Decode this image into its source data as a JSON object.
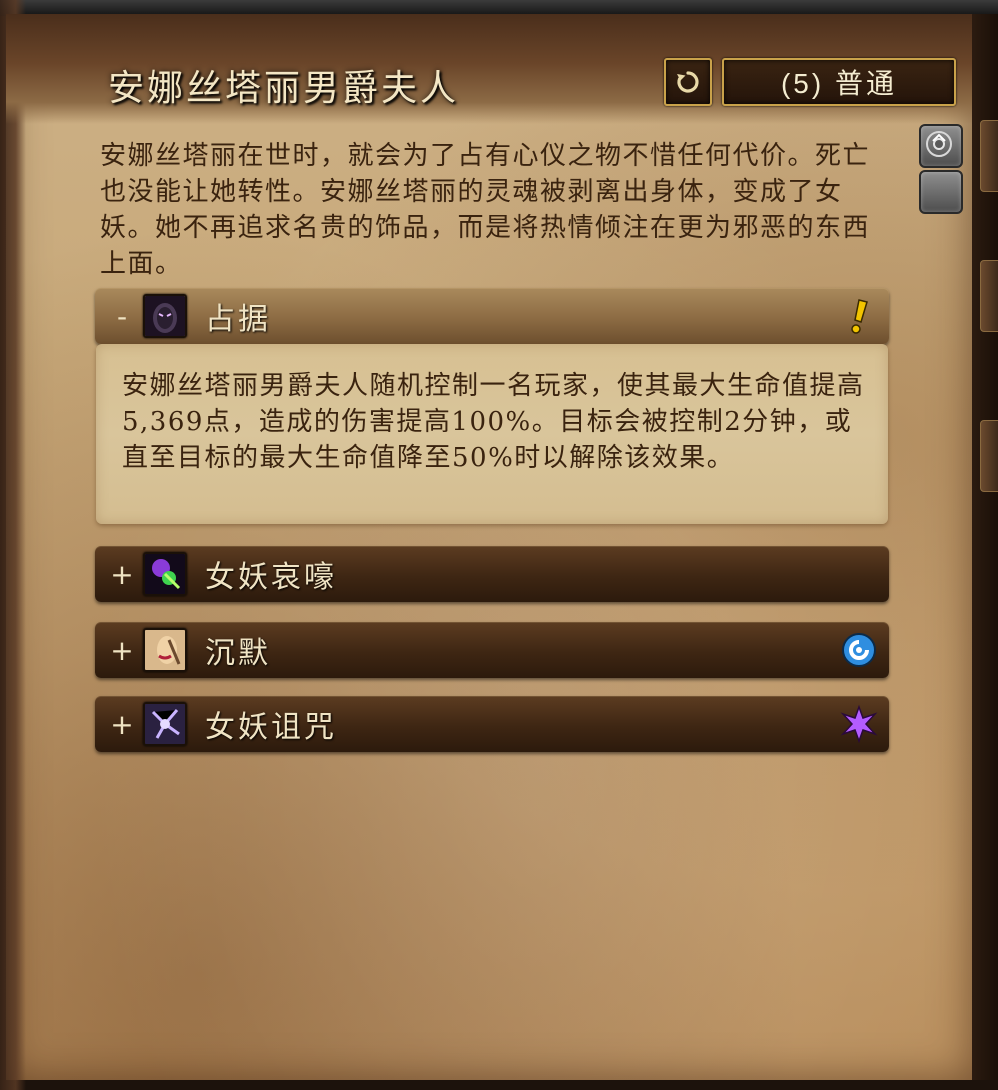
{
  "encounter": {
    "title": "安娜丝塔丽男爵夫人",
    "difficulty": "(5) 普通",
    "description": "安娜丝塔丽在世时，就会为了占有心仪之物不惜任何代价。死亡也没能让她转性。安娜丝塔丽的灵魂被剥离出身体，变成了女妖。她不再追求名贵的饰品，而是将热情倾注在更为邪恶的东西上面。"
  },
  "abilities": [
    {
      "toggle": "-",
      "name": "占据",
      "icon": "possess-icon",
      "flag": "important-exclamation-icon",
      "expanded": true,
      "detail": "安娜丝塔丽男爵夫人随机控制一名玩家，使其最大生命值提高5,369点，造成的伤害提高100%。目标会被控制2分钟，或直至目标的最大生命值降至50%时以解除该效果。"
    },
    {
      "toggle": "+",
      "name": "女妖哀嚎",
      "icon": "banshee-wail-icon",
      "flag": "",
      "expanded": false
    },
    {
      "toggle": "+",
      "name": "沉默",
      "icon": "silence-icon",
      "flag": "interruptible-icon",
      "expanded": false
    },
    {
      "toggle": "+",
      "name": "女妖诅咒",
      "icon": "banshee-curse-icon",
      "flag": "magic-effect-icon",
      "expanded": false
    }
  ],
  "colors": {
    "accent_gold": "#c9a24a",
    "title_text": "#f3e6c4",
    "body_text": "#3a230f",
    "flag_yellow": "#f2c400",
    "flag_blue": "#2f8ee0",
    "flag_purple": "#b45cff"
  }
}
